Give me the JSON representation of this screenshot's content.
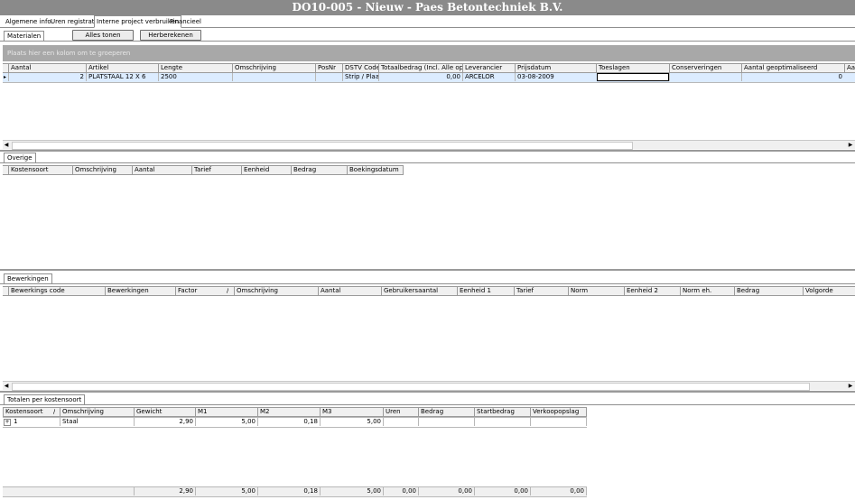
{
  "window": {
    "title": "DO10-005 - Nieuw - Paes Betontechniek B.V."
  },
  "top_tabs": [
    "Algemene info.",
    "Uren registratie",
    "Interne project verbruiken",
    "Financieel"
  ],
  "materialen": {
    "tab_label": "Materialen",
    "buttons": {
      "show_all": "Alles tonen",
      "recalc": "Herberekenen"
    },
    "group_hint": "Plaats hier een kolom om te groeperen",
    "columns": [
      "Aantal",
      "Artikel",
      "Lengte",
      "Omschrijving",
      "PosNr",
      "DSTV Code",
      "Totaalbedrag (Incl. Alle opslag",
      "Leverancier",
      "Prijsdatum",
      "Toeslagen",
      "Conserveringen",
      "Aantal geoptimaliseerd",
      "Aa"
    ],
    "row": {
      "aantal": "2",
      "artikel": "PLATSTAAL 12 X 6",
      "lengte": "2500",
      "omschrijving": "",
      "posnr": "",
      "dstv": "Strip / Plaat",
      "totaal": "0,00",
      "leverancier": "ARCELOR",
      "prijsdatum": "03-08-2009",
      "toeslagen": "",
      "conserveringen": "",
      "aantal_opt": "0"
    }
  },
  "overige": {
    "tab_label": "Overige",
    "columns": [
      "Kostensoort",
      "Omschrijving",
      "Aantal",
      "Tarief",
      "Eenheid",
      "Bedrag",
      "Boekingsdatum"
    ]
  },
  "bewerkingen": {
    "tab_label": "Bewerkingen",
    "columns": [
      "Bewerkings code",
      "Bewerkingen",
      "Factor",
      "Omschrijving",
      "Aantal",
      "Gebruikersaantal",
      "Eenheid 1",
      "Tarief",
      "Norm",
      "Eenheid 2",
      "Norm eh.",
      "Bedrag",
      "Volgorde"
    ],
    "sort_indicator": "/"
  },
  "totalen": {
    "tab_label": "Totalen per kostensoort",
    "columns": [
      "Kostensoort",
      "Omschrijving",
      "Gewicht",
      "M1",
      "M2",
      "M3",
      "Uren",
      "Bedrag",
      "Startbedrag",
      "Verkoopopslag"
    ],
    "sort_indicator": "/",
    "row": {
      "expander": "+",
      "kostensoort": "1",
      "omschrijving": "Staal",
      "gewicht": "2,90",
      "m1": "5,00",
      "m2": "0,18",
      "m3": "5,00",
      "uren": "",
      "bedrag": "",
      "startbedrag": "",
      "verkoopopslag": ""
    },
    "summary": [
      "2,90",
      "5,00",
      "0,18",
      "5,00",
      "0,00",
      "0,00",
      "0,00",
      "0,00"
    ]
  },
  "icons": {
    "row_indicator": "row-pointer-icon",
    "scroll_left": "arrow-left-icon",
    "scroll_right": "arrow-right-icon"
  }
}
